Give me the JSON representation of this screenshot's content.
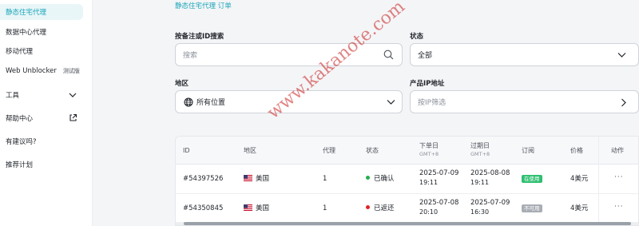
{
  "sidebar": {
    "items": [
      {
        "label": "静态住宅代理",
        "active": true
      },
      {
        "label": "数据中心代理"
      },
      {
        "label": "移动代理"
      },
      {
        "label": "Web Unblocker",
        "badge": "测试版"
      },
      {
        "label": "工具",
        "icon": "chevron-down-icon"
      },
      {
        "label": "帮助中心",
        "icon": "external-link-icon"
      },
      {
        "label": "有建议吗?"
      },
      {
        "label": "推荐计划"
      }
    ]
  },
  "breadcrumb": {
    "text": "静态住宅代理 订单"
  },
  "filters": {
    "search_label": "按备注或ID搜索",
    "search_placeholder": "搜索",
    "status_label": "状态",
    "status_value": "全部",
    "region_label": "地区",
    "region_value": "所有位置",
    "ip_label": "产品IP地址",
    "ip_placeholder": "按IP筛选"
  },
  "table": {
    "headers": {
      "id": "ID",
      "region": "地区",
      "proxy": "代理",
      "status": "状态",
      "order_date": "下单日",
      "order_date_tz": "GMT+8",
      "expire_date": "过期日",
      "expire_date_tz": "GMT+8",
      "subscription": "订阅",
      "price": "价格",
      "action": "动作"
    },
    "rows": [
      {
        "id": "#54397526",
        "region": "美国",
        "proxy": "1",
        "status": "已确认",
        "status_color": "#22b14c",
        "order_date": "2025-07-09",
        "order_time": "19:11",
        "expire_date": "2025-08-08",
        "expire_time": "19:11",
        "subscription": "在使用",
        "subscription_bg": "#2fbf71",
        "price": "4美元",
        "action": "···"
      },
      {
        "id": "#54350845",
        "region": "美国",
        "proxy": "1",
        "status": "已返还",
        "status_color": "#e02424",
        "order_date": "2025-07-08",
        "order_time": "20:10",
        "expire_date": "2025-07-09",
        "expire_time": "16:30",
        "subscription": "不可用",
        "subscription_bg": "#a9aeb5",
        "price": "4美元",
        "action": "···"
      }
    ]
  },
  "watermark": "www.kakanote.com"
}
